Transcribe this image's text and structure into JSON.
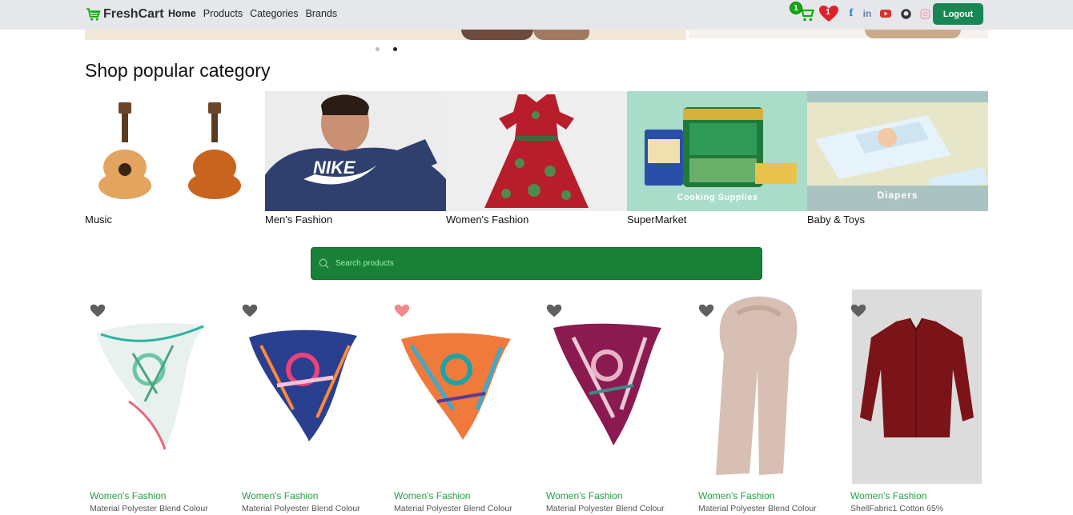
{
  "navbar": {
    "brand": "FreshCart",
    "links": [
      "Home",
      "Products",
      "Categories",
      "Brands"
    ],
    "active_link": "Home",
    "cart_count": "1",
    "wishlist_count": "1",
    "social_icons": [
      "facebook-icon",
      "linkedin-icon",
      "youtube-icon",
      "github-icon",
      "instagram-icon"
    ],
    "logout_label": "Logout"
  },
  "slider": {
    "dots": 2,
    "active_dot": 2
  },
  "popular": {
    "title": "Shop popular category",
    "categories": [
      {
        "label": "Music",
        "image": "guitars"
      },
      {
        "label": "Men's Fashion",
        "image": "nike-hoodie-man"
      },
      {
        "label": "Women's Fashion",
        "image": "floral-dress"
      },
      {
        "label": "SuperMarket",
        "image": "cooking-supplies",
        "overlay_text": "Cooking Supplies"
      },
      {
        "label": "Baby & Toys",
        "image": "diapers",
        "overlay_text": "Diapers"
      }
    ]
  },
  "search": {
    "placeholder": "Search products"
  },
  "products": [
    {
      "category": "Women's Fashion",
      "title": "Material Polyester Blend Colour",
      "wishlisted": false,
      "image": "white-green-scarf"
    },
    {
      "category": "Women's Fashion",
      "title": "Material Polyester Blend Colour",
      "wishlisted": false,
      "image": "navy-pink-scarf"
    },
    {
      "category": "Women's Fashion",
      "title": "Material Polyester Blend Colour",
      "wishlisted": true,
      "image": "orange-teal-scarf"
    },
    {
      "category": "Women's Fashion",
      "title": "Material Polyester Blend Colour",
      "wishlisted": false,
      "image": "plum-scarf"
    },
    {
      "category": "Women's Fashion",
      "title": "Material Polyester Blend Colour",
      "wishlisted": false,
      "image": "beige-scarf"
    },
    {
      "category": "Women's Fashion",
      "title": "ShellFabric1 Cotton 65%",
      "wishlisted": false,
      "image": "maroon-shirt"
    }
  ],
  "colors": {
    "accent_green": "#198754",
    "category_green": "#22a044",
    "heart_gray": "#5f5f5f",
    "heart_active": "#f08a8a",
    "wish_red": "#e0202a"
  }
}
